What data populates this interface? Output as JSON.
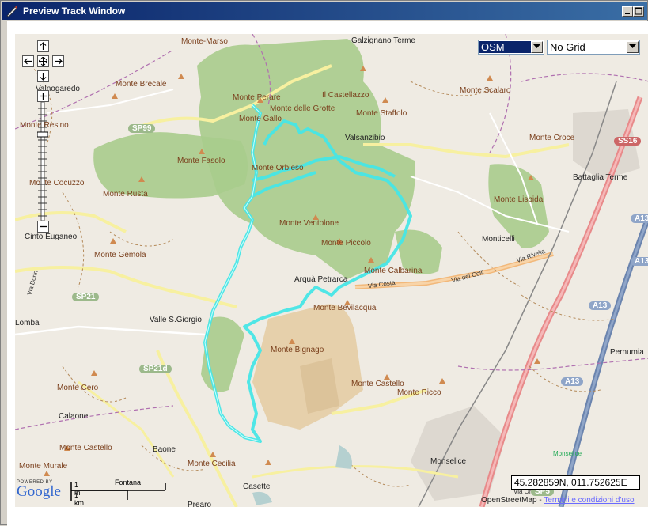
{
  "window": {
    "title": "Preview Track Window"
  },
  "map_type_select": {
    "value": "OSM"
  },
  "grid_select": {
    "value": "No Grid"
  },
  "coordinates": "45.282859N, 011.752625E",
  "attribution": {
    "text": "OpenStreetMap - ",
    "link": "Termini e condizioni d'uso"
  },
  "scale": {
    "miles": "1 mi",
    "km": "1 km",
    "place": "Fontana"
  },
  "google": {
    "powered_by": "POWERED BY",
    "logo": "Google"
  },
  "colors": {
    "track": "#46e6e6",
    "park": "#a8cc8c",
    "titlebar": "#0a246a",
    "motorway": "#8fa5c8",
    "primary": "#e88a8a"
  },
  "map_labels": {
    "monte_marso": "Monte-Marso",
    "galzignano": "Galzignano Terme",
    "valnogaredo": "Valnogaredo",
    "monte_brecale": "Monte Brecale",
    "monte_perare": "Monte Perare",
    "monte_delle_grotte": "Monte delle Grotte",
    "il_castellazzo": "Il Castellazzo",
    "monte_scalaro": "Monte Scalaro",
    "monte_resino": "Monte Resino",
    "monte_gallo": "Monte Gallo",
    "monte_staffolo": "Monte Staffolo",
    "sp99": "SP99",
    "valsanzibio": "Valsanzibio",
    "monte_croce": "Monte Croce",
    "ss16": "SS16",
    "monte_fasolo": "Monte Fasolo",
    "monte_orbieso": "Monte Orbieso",
    "battaglia_terme": "Battaglia Terme",
    "monte_cocuzzo": "Monte Cocuzzo",
    "monte_rusta": "Monte Rusta",
    "monte_lispida": "Monte Lispida",
    "a13_1": "A13",
    "monte_ventolone": "Monte Ventolone",
    "cinto_euganeo": "Cinto Euganeo",
    "monticelli": "Monticelli",
    "monte_gemola": "Monte Gemola",
    "monte_piccolo": "Monte Piccolo",
    "via_rivella": "Via Rivella",
    "a13_2": "A13",
    "monte_calbarina": "Monte Calbarina",
    "arqua_petrarca": "Arquà Petrarca",
    "via_costa": "Via Costa",
    "via_dei_colli": "Via dei Colli",
    "sp21": "SP21",
    "monte_bevilacqua": "Monte Bevilacqua",
    "a13_3": "A13",
    "lombardia": "Lomba",
    "valle_s_giorgio": "Valle S.Giorgio",
    "monte_bignago": "Monte Bignago",
    "pernumia": "Pernumia",
    "sp21d": "SP21d",
    "monte_cero": "Monte Cero",
    "monte_castello": "Monte Castello",
    "monte_ricco": "Monte Ricco",
    "a13_4": "A13",
    "calaone": "Calaone",
    "monte_castello_2": "Monte Castello",
    "baone": "Baone",
    "monselice_small": "Monselice",
    "monte_murale": "Monte Murale",
    "monte_cecilia": "Monte Cecilia",
    "monselice": "Monselice",
    "casette": "Casette",
    "prearo": "Prearo",
    "via_borin": "Via Borin",
    "via_orti": "Via Orti",
    "sp5": "SP5"
  }
}
